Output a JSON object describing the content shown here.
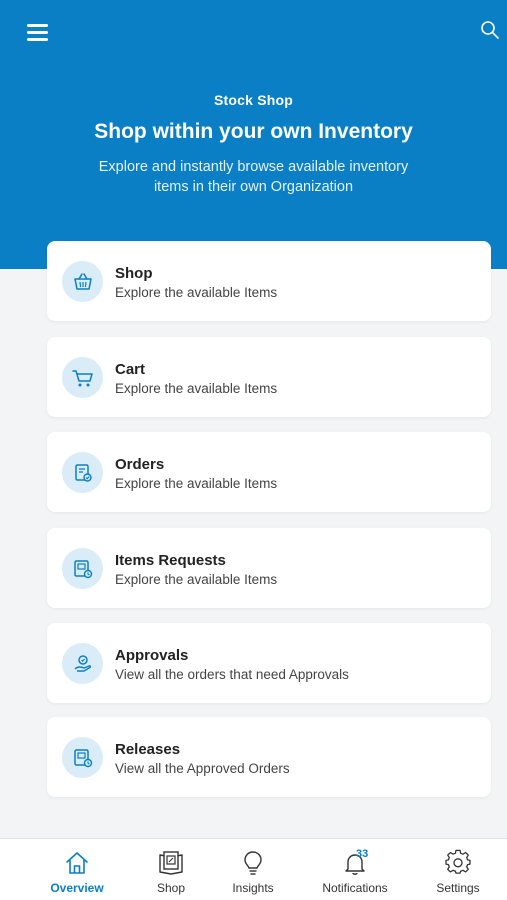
{
  "header": {
    "eyebrow": "Stock Shop",
    "title": "Shop within your own Inventory",
    "subtitle": "Explore and instantly browse available inventory items in their own  Organization",
    "menu_icon": "hamburger-menu-icon",
    "search_icon": "search-icon"
  },
  "colors": {
    "brand": "#0a7fc6",
    "icon_bg": "#d9ecf8",
    "background": "#f3f4f6"
  },
  "cards": [
    {
      "title": "Shop",
      "description": "Explore the available Items",
      "icon": "basket-icon"
    },
    {
      "title": "Cart",
      "description": "Explore the available Items",
      "icon": "cart-icon"
    },
    {
      "title": "Orders",
      "description": "Explore the available Items",
      "icon": "orders-icon"
    },
    {
      "title": "Items Requests",
      "description": "Explore the available Items",
      "icon": "item-request-icon"
    },
    {
      "title": "Approvals",
      "description": "View all the orders that need Approvals",
      "icon": "approval-icon"
    },
    {
      "title": "Releases",
      "description": "View all the Approved Orders",
      "icon": "release-icon"
    }
  ],
  "tabbar": {
    "tabs": [
      {
        "label": "Overview",
        "icon": "home-icon",
        "active": true
      },
      {
        "label": "Shop",
        "icon": "shop-book-icon"
      },
      {
        "label": "Insights",
        "icon": "lightbulb-icon"
      },
      {
        "label": "Notifications",
        "icon": "bell-icon",
        "badge": "33"
      },
      {
        "label": "Settings",
        "icon": "gear-icon"
      }
    ]
  }
}
